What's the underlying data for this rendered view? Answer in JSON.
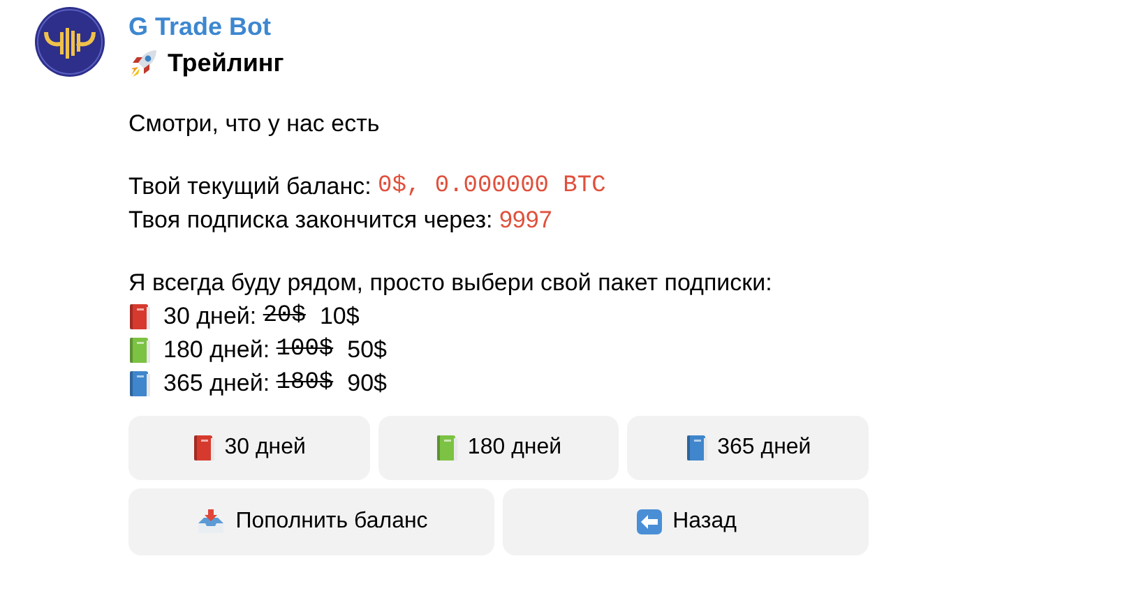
{
  "sender": {
    "name": "G Trade Bot"
  },
  "header": {
    "kind": "rocket",
    "text": "Трейлинг"
  },
  "intro": "Смотри, что у нас есть",
  "balance": {
    "label": "Твой текущий баланс: ",
    "value": "0$, 0.000000 BTC"
  },
  "subscription": {
    "label": "Твоя подписка закончится через: ",
    "value": "9997"
  },
  "plans_intro": "Я всегда буду рядом, просто выбери свой пакет подписки:",
  "plans": [
    {
      "color": "#d63a2f",
      "label": "30 дней: ",
      "old_price": "20$",
      "new_price": "10$"
    },
    {
      "color": "#7cc243",
      "label": "180 дней: ",
      "old_price": "100$",
      "new_price": "50$"
    },
    {
      "color": "#3f86cc",
      "label": "365 дней: ",
      "old_price": "180$",
      "new_price": "90$"
    }
  ],
  "keyboard": [
    [
      {
        "kind": "book",
        "color": "#d63a2f",
        "label": "30 дней"
      },
      {
        "kind": "book",
        "color": "#7cc243",
        "label": "180 дней"
      },
      {
        "kind": "book",
        "color": "#3f86cc",
        "label": "365 дней"
      }
    ],
    [
      {
        "kind": "inbox",
        "label": "Пополнить баланс"
      },
      {
        "kind": "back",
        "label": "Назад"
      }
    ]
  ]
}
